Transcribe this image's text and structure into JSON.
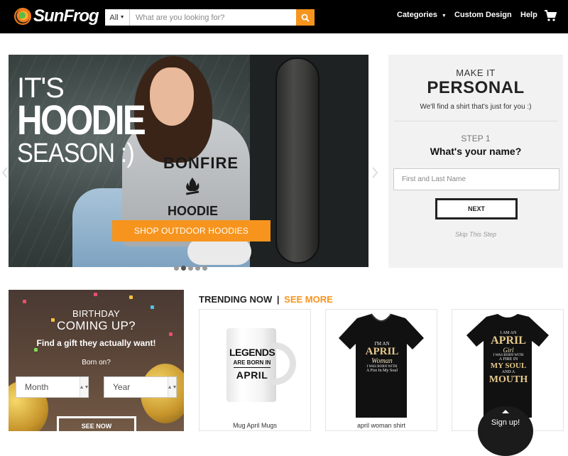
{
  "header": {
    "brand": "SunFrog",
    "search_category": "All",
    "search_placeholder": "What are you looking for?",
    "nav": {
      "categories": "Categories",
      "custom_design": "Custom Design",
      "help": "Help"
    },
    "icons": [
      "search-icon",
      "cart-icon",
      "caret-down-icon"
    ],
    "accent_color": "#f7941d"
  },
  "hero": {
    "line1": "IT'S",
    "line2": "HOODIE",
    "line3": "SEASON :)",
    "hoodie_print_top": "BONFIRE",
    "hoodie_print_bottom": "HOODIE",
    "cta": "SHOP OUTDOOR HOODIES",
    "slide_count": 5,
    "active_slide": 2
  },
  "personal": {
    "make_it": "MAKE IT",
    "title": "PERSONAL",
    "subtitle": "We'll find a shirt that's just for you :)",
    "step": "STEP 1",
    "question": "What's your name?",
    "name_placeholder": "First and Last Name",
    "next_button": "NEXT",
    "skip": "Skip This Step"
  },
  "birthday": {
    "title1": "BIRTHDAY",
    "title2": "COMING UP?",
    "subtitle": "Find a gift they actually want!",
    "born_on": "Born on?",
    "month": "Month",
    "year": "Year",
    "cta": "SEE NOW"
  },
  "trending": {
    "heading": "TRENDING NOW",
    "separator": "|",
    "see_more": "SEE MORE",
    "items": [
      {
        "label": "Mug April Mugs",
        "print": [
          "LEGENDS",
          "ARE BORN IN",
          "APRIL"
        ]
      },
      {
        "label": "april woman shirt",
        "print": [
          "I'M AN",
          "APRIL",
          "Woman",
          "I WAS BORN WITH",
          "A Fire In My Soul"
        ]
      },
      {
        "label": "",
        "print": [
          "I AM AN",
          "APRIL",
          "Girl",
          "I WAS BORN WITH",
          "A FIRE IN",
          "MY SOUL",
          "AND A",
          "MOUTH"
        ]
      }
    ]
  },
  "signup": {
    "label": "Sign up!"
  }
}
